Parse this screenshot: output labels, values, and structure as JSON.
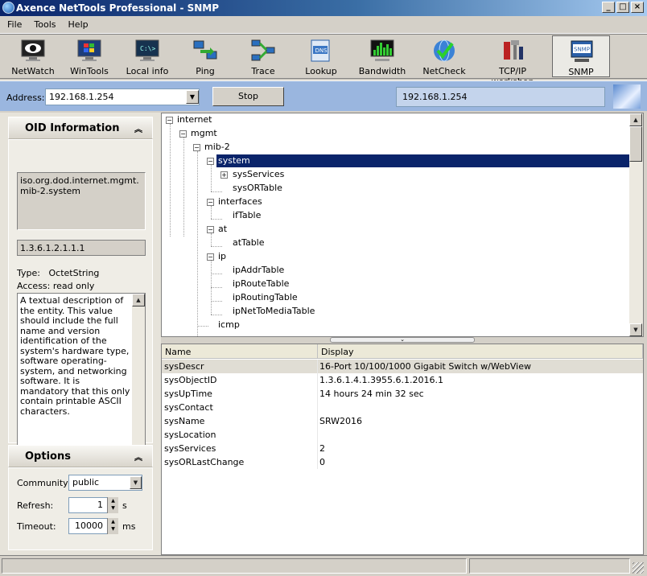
{
  "window": {
    "title": "Axence NetTools Professional - SNMP",
    "minimize": "_",
    "maximize": "□",
    "close": "×"
  },
  "menu": [
    "File",
    "Tools",
    "Help"
  ],
  "toolbar": [
    {
      "label": "NetWatch",
      "icon": "eye-monitor-icon"
    },
    {
      "label": "WinTools",
      "icon": "windows-monitor-icon"
    },
    {
      "label": "Local info",
      "icon": "terminal-monitor-icon"
    },
    {
      "label": "Ping",
      "icon": "ping-computers-icon"
    },
    {
      "label": "Trace",
      "icon": "trace-network-icon"
    },
    {
      "label": "Lookup",
      "icon": "dns-document-icon"
    },
    {
      "label": "Bandwidth",
      "icon": "bandwidth-bars-icon"
    },
    {
      "label": "NetCheck",
      "icon": "check-globe-icon"
    },
    {
      "label": "TCP/IP workshop",
      "icon": "tools-icon"
    },
    {
      "label": "SNMP",
      "icon": "snmp-icon",
      "active": true
    }
  ],
  "address": {
    "label": "Address:",
    "value": "192.168.1.254",
    "stop_label": "Stop",
    "display": "192.168.1.254"
  },
  "oid": {
    "header": "OID Information",
    "path": "iso.org.dod.internet.mgmt.mib-2.system",
    "number": "1.3.6.1.2.1.1.1",
    "type_label": "Type:",
    "type_value": "OctetString",
    "access": "Access: read only",
    "description": "A textual description of the entity. This value should include the full name and version identification of the system's hardware type, software operating-system, and networking software. It is mandatory that this only contain printable ASCII characters."
  },
  "options": {
    "header": "Options",
    "community_label": "Community:",
    "community_value": "public",
    "refresh_label": "Refresh:",
    "refresh_value": "1",
    "refresh_unit": "s",
    "timeout_label": "Timeout:",
    "timeout_value": "10000",
    "timeout_unit": "ms"
  },
  "tree": {
    "internet": "internet",
    "mgmt": "mgmt",
    "mib2": "mib-2",
    "system": "system",
    "sysServices": "sysServices",
    "sysORTable": "sysORTable",
    "interfaces": "interfaces",
    "ifTable": "ifTable",
    "at": "at",
    "atTable": "atTable",
    "ip": "ip",
    "ipAddrTable": "ipAddrTable",
    "ipRouteTable": "ipRouteTable",
    "ipRoutingTable": "ipRoutingTable",
    "ipNetToMediaTable": "ipNetToMediaTable",
    "icmp": "icmp"
  },
  "table": {
    "headers": [
      "Name",
      "Display"
    ],
    "rows": [
      {
        "name": "sysDescr",
        "display": "16-Port 10/100/1000 Gigabit Switch w/WebView"
      },
      {
        "name": "sysObjectID",
        "display": "1.3.6.1.4.1.3955.6.1.2016.1"
      },
      {
        "name": "sysUpTime",
        "display": "14 hours 24 min 32 sec"
      },
      {
        "name": "sysContact",
        "display": ""
      },
      {
        "name": "sysName",
        "display": "SRW2016"
      },
      {
        "name": "sysLocation",
        "display": ""
      },
      {
        "name": "sysServices",
        "display": "2"
      },
      {
        "name": "sysORLastChange",
        "display": "0"
      }
    ]
  }
}
